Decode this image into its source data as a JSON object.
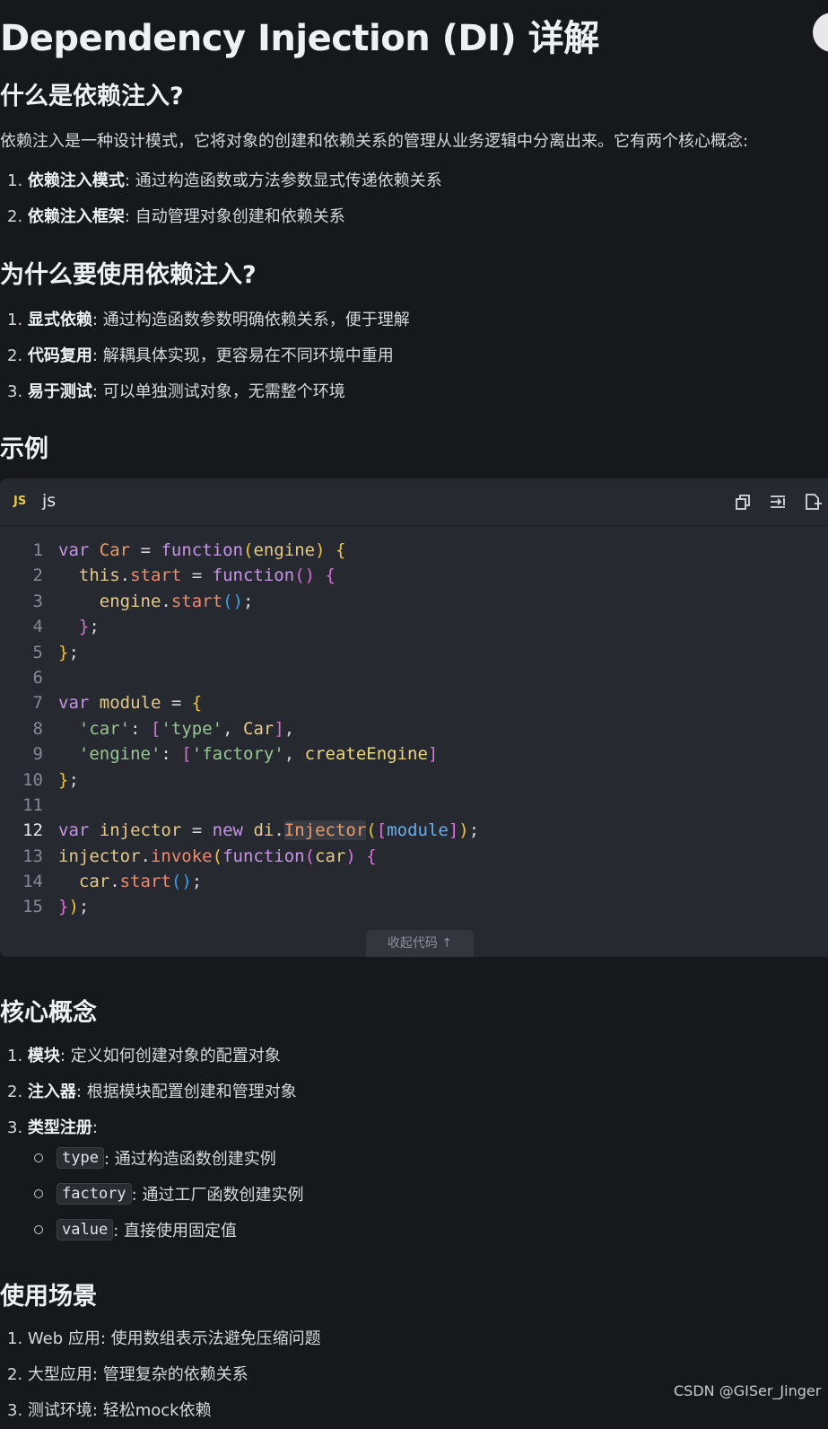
{
  "title": "Dependency Injection (DI) 详解",
  "sections": {
    "what": {
      "heading": "什么是依赖注入?",
      "intro": "依赖注入是一种设计模式，它将对象的创建和依赖关系的管理从业务逻辑中分离出来。它有两个核心概念:",
      "items": [
        {
          "num": "1.",
          "bold": "依赖注入模式",
          "text": ": 通过构造函数或方法参数显式传递依赖关系"
        },
        {
          "num": "2.",
          "bold": "依赖注入框架",
          "text": ": 自动管理对象创建和依赖关系"
        }
      ]
    },
    "why": {
      "heading": "为什么要使用依赖注入?",
      "items": [
        {
          "num": "1.",
          "bold": "显式依赖",
          "text": ": 通过构造函数参数明确依赖关系，便于理解"
        },
        {
          "num": "2.",
          "bold": "代码复用",
          "text": ": 解耦具体实现，更容易在不同环境中重用"
        },
        {
          "num": "3.",
          "bold": "易于测试",
          "text": ": 可以单独测试对象，无需整个环境"
        }
      ]
    },
    "example": {
      "heading": "示例"
    },
    "core": {
      "heading": "核心概念",
      "items": [
        {
          "num": "1.",
          "bold": "模块",
          "text": ": 定义如何创建对象的配置对象"
        },
        {
          "num": "2.",
          "bold": "注入器",
          "text": ": 根据模块配置创建和管理对象"
        },
        {
          "num": "3.",
          "bold": "类型注册",
          "text": ":"
        }
      ],
      "subitems": [
        {
          "code": "type",
          "text": ": 通过构造函数创建实例"
        },
        {
          "code": "factory",
          "text": ": 通过工厂函数创建实例"
        },
        {
          "code": "value",
          "text": ": 直接使用固定值"
        }
      ]
    },
    "usage": {
      "heading": "使用场景",
      "items": [
        {
          "num": "1.",
          "text": "Web 应用: 使用数组表示法避免压缩问题"
        },
        {
          "num": "2.",
          "text": "大型应用: 管理复杂的依赖关系"
        },
        {
          "num": "3.",
          "text": "测试环境: 轻松mock依赖"
        }
      ]
    }
  },
  "code_block": {
    "lang_icon": "JS",
    "language": "js",
    "toolbar_icons": [
      "copy-icon",
      "wrap-icon",
      "insert-icon"
    ],
    "line_numbers": [
      "1",
      "2",
      "3",
      "4",
      "5",
      "6",
      "7",
      "8",
      "9",
      "10",
      "11",
      "12",
      "13",
      "14",
      "15"
    ],
    "highlight_line": "12",
    "collapse_label": "收起代码 ↑"
  },
  "watermark": "CSDN @GISer_Jinger"
}
